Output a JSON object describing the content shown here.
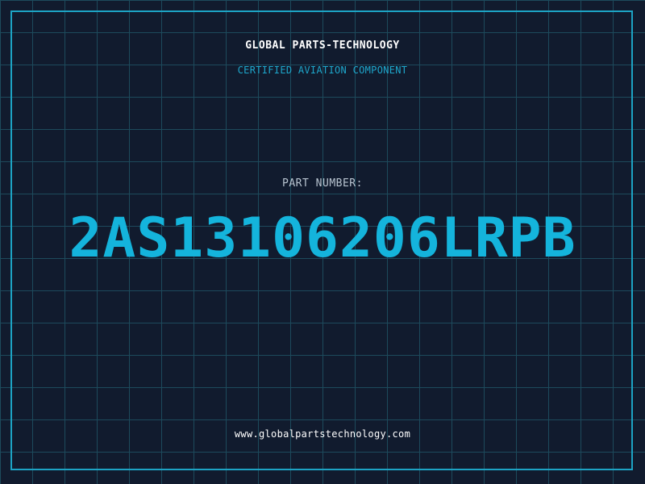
{
  "header": {
    "company": "GLOBAL PARTS-TECHNOLOGY",
    "subtitle": "CERTIFIED AVIATION COMPONENT"
  },
  "part": {
    "label": "PART NUMBER:",
    "number": "2AS13106206LRPB"
  },
  "footer": {
    "website": "www.globalpartstechnology.com"
  },
  "colors": {
    "background": "#111b2e",
    "grid": "#1d4a5c",
    "frame": "#1da3c4",
    "accent": "#14b4dc"
  }
}
